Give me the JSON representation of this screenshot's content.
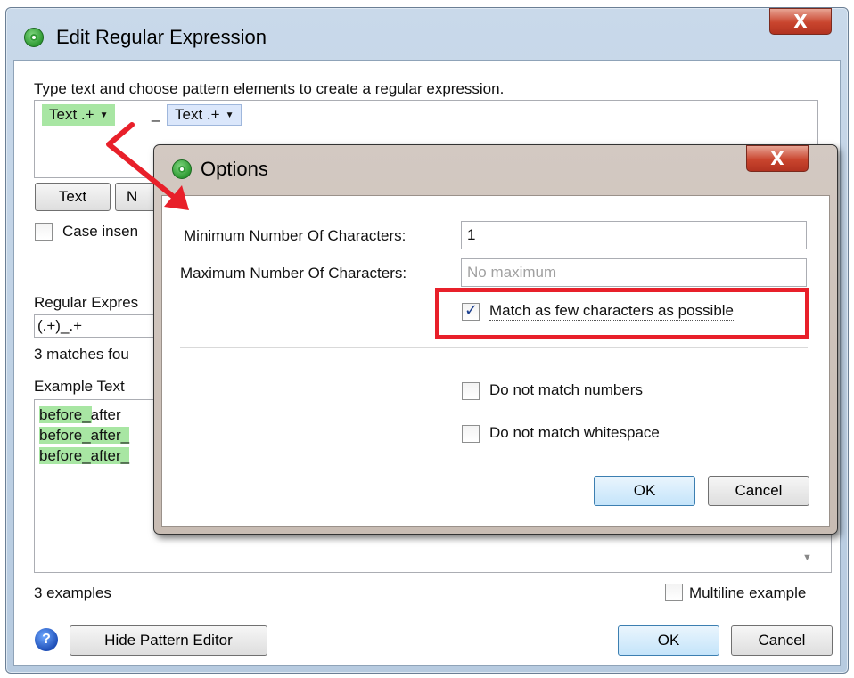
{
  "main_window": {
    "title": "Edit Regular Expression",
    "close_glyph": "X",
    "instruction": "Type text and choose pattern elements to create a regular expression.",
    "tokens": [
      {
        "label": "Text .+",
        "color": "#a8e6a3"
      },
      {
        "label": "Text .+",
        "color": "#dbe7fb"
      }
    ],
    "token_separator": "_",
    "text_button": "Text",
    "partial_button": "N",
    "case_insensitive_label": "Case insen",
    "regex_label": "Regular Expres",
    "regex_value": "(.+)_.+",
    "match_count": "3 matches fou",
    "example_label": "Example Text",
    "examples": [
      "before_after",
      "before_after_",
      "before_after_"
    ],
    "example_count": "3 examples",
    "multiline_label": "Multiline example",
    "help_icon": "?",
    "hide_editor_button": "Hide Pattern Editor",
    "ok_button": "OK",
    "cancel_button": "Cancel"
  },
  "options_dialog": {
    "title": "Options",
    "close_glyph": "X",
    "min_label": "Minimum Number Of Characters:",
    "min_value": "1",
    "max_label": "Maximum Number Of Characters:",
    "max_placeholder": "No maximum",
    "match_few_label": "Match as few characters as possible",
    "match_few_checked": true,
    "no_numbers_label": "Do not match numbers",
    "no_whitespace_label": "Do not match whitespace",
    "ok_button": "OK",
    "cancel_button": "Cancel"
  },
  "colors": {
    "match_highlight": "#a8e6a3",
    "annotation_red": "#e8202a"
  }
}
